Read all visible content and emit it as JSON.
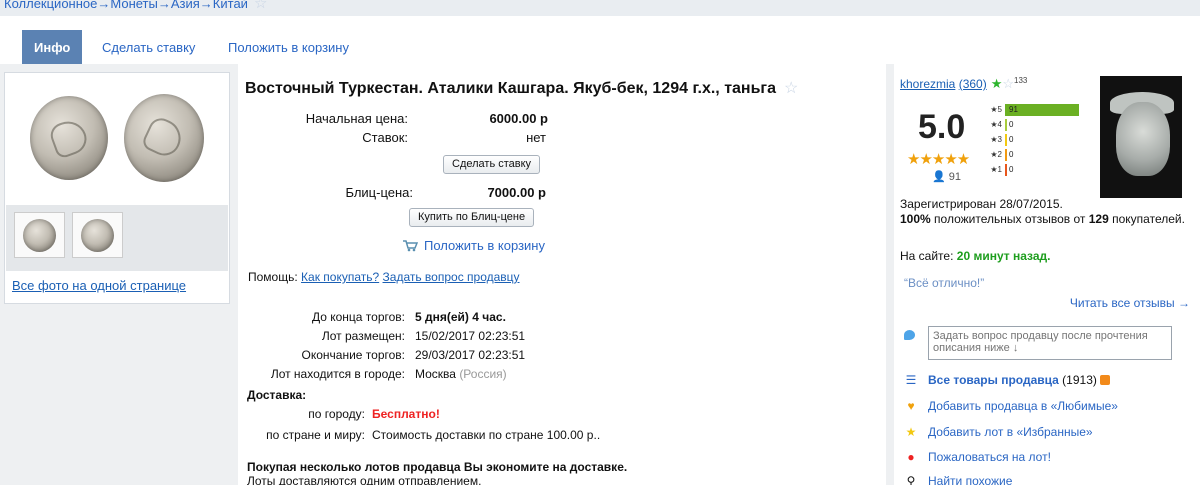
{
  "breadcrumb": {
    "items": [
      "Коллекционное",
      "Монеты",
      "Азия",
      "Китай"
    ],
    "separator": "→"
  },
  "tabs": [
    {
      "label": "Инфо",
      "active": true
    },
    {
      "label": "Сделать ставку",
      "active": false
    },
    {
      "label": "Положить в корзину",
      "active": false
    }
  ],
  "photos": {
    "all_photos_link": "Все фото на одной странице"
  },
  "lot": {
    "title": "Восточный Туркестан. Аталики Кашгара. Якуб-бек, 1294 г.х., таньга",
    "start_price_label": "Начальная цена:",
    "start_price_value": "6000.00 р",
    "bids_label": "Ставок:",
    "bids_value": "нет",
    "bid_button": "Сделать ставку",
    "blitz_label": "Блиц-цена:",
    "blitz_value": "7000.00 р",
    "blitz_button": "Купить по Блиц-цене",
    "basket_link": "Положить в корзину",
    "help_label": "Помощь:",
    "help_how_to_buy": "Как покупать?",
    "help_ask_seller": "Задать вопрос продавцу",
    "time_left_label": "До конца торгов:",
    "time_left_value": "5 дня(ей) 4 час.",
    "placed_label": "Лот размещен:",
    "placed_value": "15/02/2017 02:23:51",
    "ends_label": "Окончание торгов:",
    "ends_value": "29/03/2017 02:23:51",
    "city_label": "Лот находится в городе:",
    "city_value": "Москва",
    "country_value": "(Россия)",
    "delivery_heading": "Доставка:",
    "delivery_city_label": "по городу:",
    "delivery_city_value": "Бесплатно!",
    "delivery_world_label": "по стране и миру:",
    "delivery_world_value": "Стоимость доставки по стране 100.00 р..",
    "multi_lot_heading": "Покупая несколько лотов продавца Вы экономите на доставке.",
    "multi_lot_note": "Лоты доставляются одним отправлением."
  },
  "seller": {
    "name": "khorezmia",
    "feedback_count": "(360)",
    "stars_badge": "133",
    "rating": "5.0",
    "votes": "91",
    "distribution": [
      {
        "label": "★5",
        "count": "91",
        "fraction": 1.0,
        "color": "#6bb023"
      },
      {
        "label": "★4",
        "count": "0",
        "fraction": 0.0,
        "color": "#a8cc3c"
      },
      {
        "label": "★3",
        "count": "0",
        "fraction": 0.0,
        "color": "#f2c811"
      },
      {
        "label": "★2",
        "count": "0",
        "fraction": 0.0,
        "color": "#f29a11"
      },
      {
        "label": "★1",
        "count": "0",
        "fraction": 0.0,
        "color": "#e8561c"
      }
    ],
    "registered": "Зарегистрирован 28/07/2015.",
    "positive_pct": "100%",
    "positive_text": "положительных отзывов от",
    "positive_count": "129",
    "positive_suffix": "покупателей.",
    "online_label": "На сайте:",
    "online_value": "20 минут назад.",
    "quote": "“Всё отлично!”",
    "read_all": "Читать все отзывы →",
    "question_placeholder": "Задать вопрос продавцу после прочтения описания ниже ↓",
    "all_items_label": "Все товары продавца",
    "all_items_count": "(1913)",
    "add_favorite_seller": "Добавить продавца в «Любимые»",
    "add_favorite_lot": "Добавить лот в «Избранные»",
    "complain": "Пожаловаться на лот!",
    "find_similar": "Найти похожие"
  }
}
